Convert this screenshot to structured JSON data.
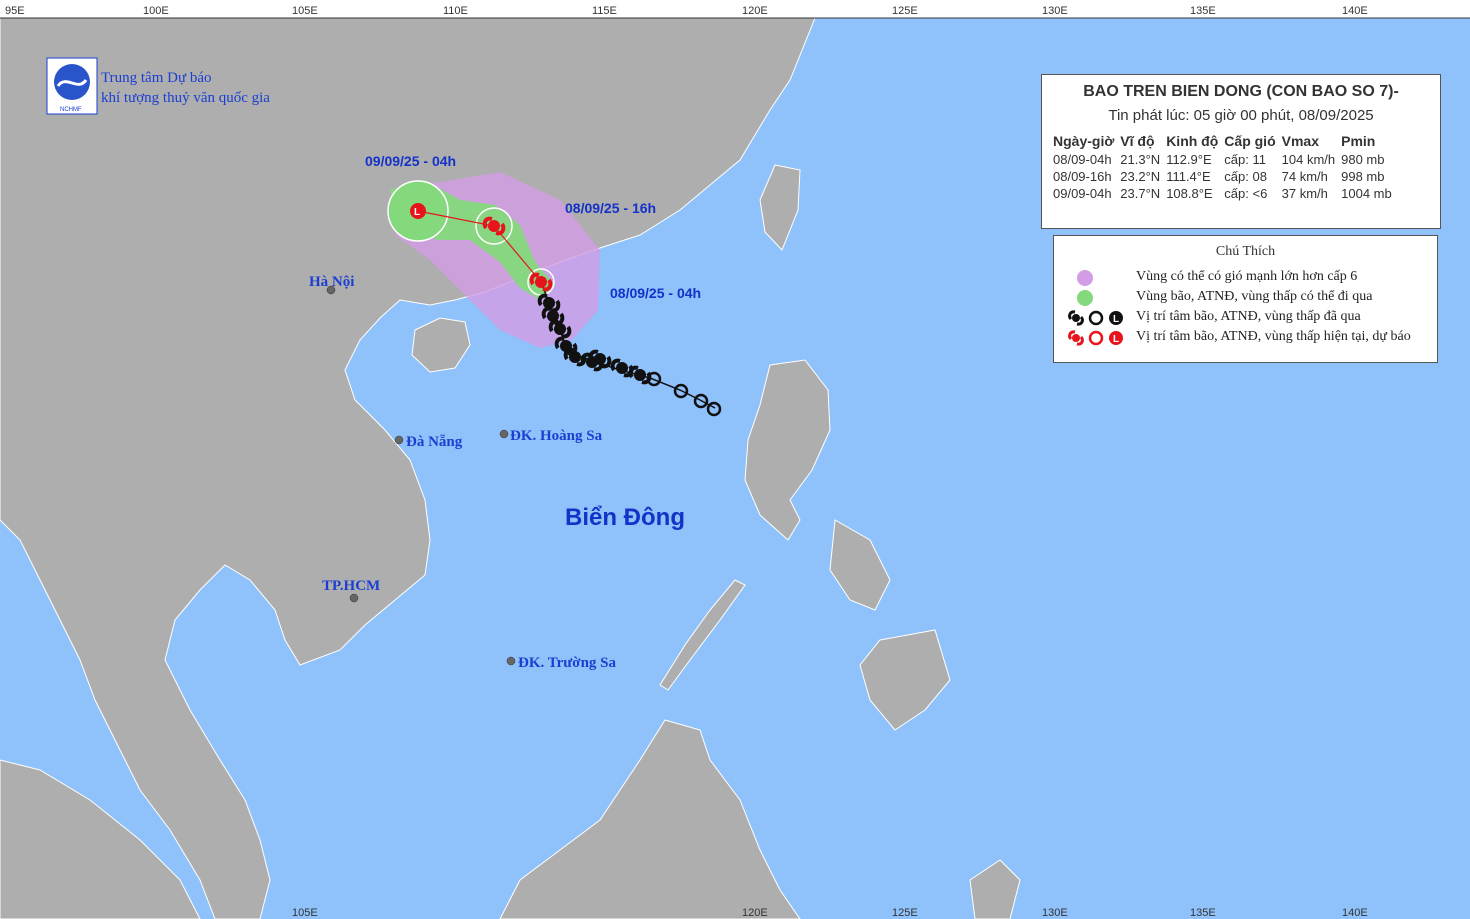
{
  "org": {
    "logo_text": "NCHMF",
    "line1": "Trung tâm Dự báo",
    "line2": "khí tượng thuỷ văn quốc gia"
  },
  "axis": {
    "top_labels": [
      "95E",
      "100E",
      "105E",
      "110E",
      "115E",
      "120E",
      "125E",
      "130E",
      "135E",
      "140E"
    ],
    "bottom_labels": [
      "105E",
      "120E",
      "125E",
      "130E",
      "135E",
      "140E"
    ],
    "left_edge_label": "5E"
  },
  "places": {
    "hanoi": "Hà Nội",
    "danang": "Đà Nẵng",
    "hoangsa": "ĐK. Hoàng Sa",
    "hcm": "TP.HCM",
    "truongsa": "ĐK. Trường Sa",
    "sea": "Biển Đông"
  },
  "track_labels": {
    "t1": "09/09/25 - 04h",
    "t2": "08/09/25 - 16h",
    "t3": "08/09/25 - 04h"
  },
  "info": {
    "title": "BAO TREN BIEN DONG (CON BAO SO 7)-",
    "issued": "Tin phát lúc: 05 giờ 00 phút, 08/09/2025",
    "headers": [
      "Ngày-giờ",
      "Vĩ độ",
      "Kinh độ",
      "Cấp gió",
      "Vmax",
      "Pmin"
    ],
    "rows": [
      [
        "08/09-04h",
        "21.3°N",
        "112.9°E",
        "cấp: 11",
        "104 km/h",
        "980 mb"
      ],
      [
        "08/09-16h",
        "23.2°N",
        "111.4°E",
        "cấp: 08",
        "74 km/h",
        "998 mb"
      ],
      [
        "09/09-04h",
        "23.7°N",
        "108.8°E",
        "cấp: <6",
        "37 km/h",
        "1004 mb"
      ]
    ]
  },
  "legend": {
    "title": "Chú Thích",
    "items": [
      "Vùng có thể có gió mạnh lớn hơn cấp 6",
      "Vùng bão, ATNĐ, vùng thấp có thể đi qua",
      "Vị trí tâm bão, ATNĐ, vùng thấp đã qua",
      "Vị trí tâm bão, ATNĐ, vùng thấp hiện tại, dự báo"
    ]
  },
  "colors": {
    "sea": "#8fc1fb",
    "land": "#aeaeae",
    "danger_zone": "#d39ce6",
    "track_zone": "#84d97c",
    "forecast_symbol": "#e8141c",
    "past_symbol": "#111111",
    "text_blue": "#1432c8"
  },
  "icons": {
    "past_storm": "black-spiral-icon",
    "past_depression": "open-circle-icon",
    "current_storm": "red-spiral-icon",
    "forecast_low": "red-L-icon"
  }
}
